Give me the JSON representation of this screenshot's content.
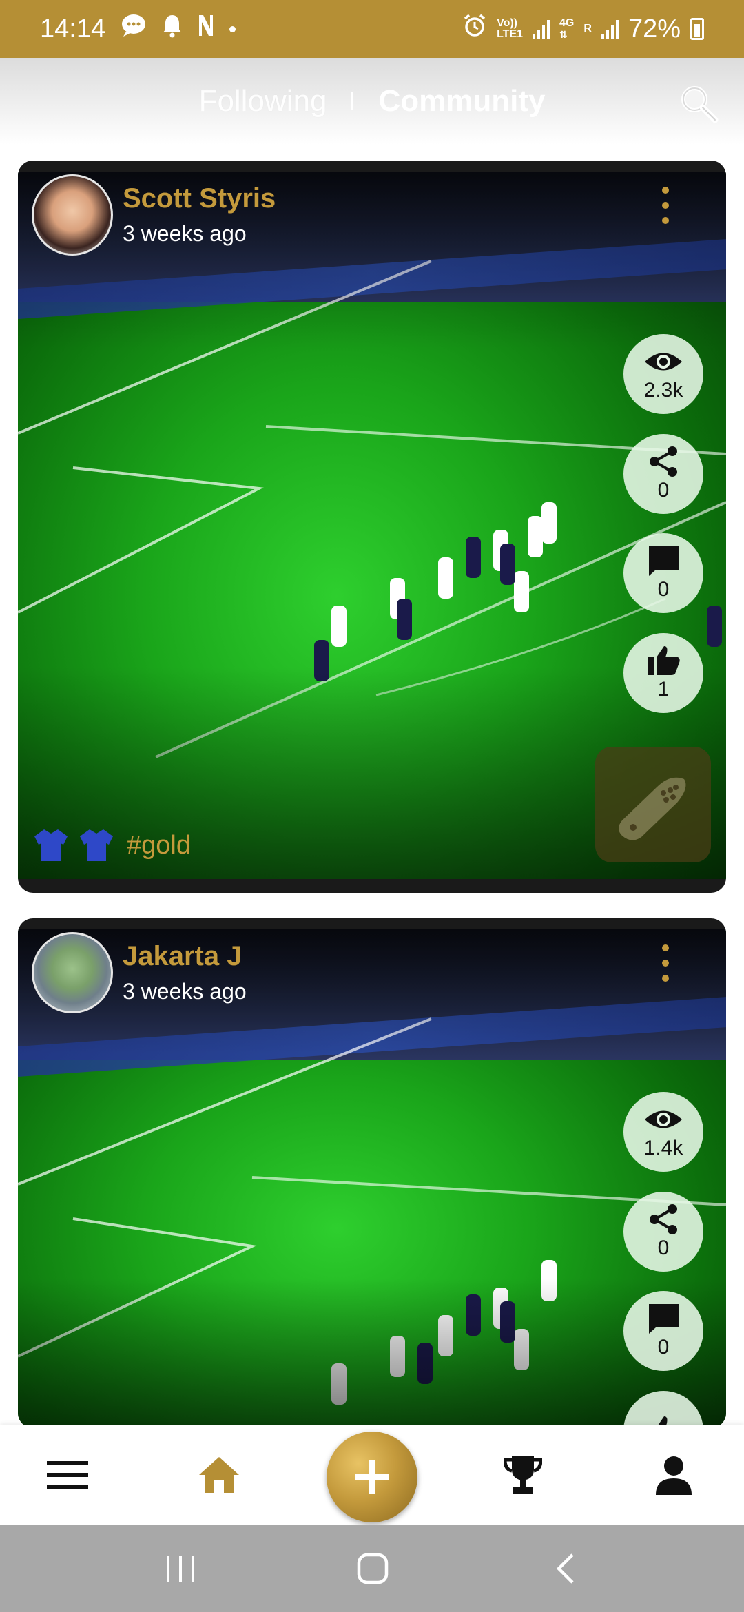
{
  "status_bar": {
    "time": "14:14",
    "notification_icons": [
      "chat-bubble-icon",
      "bell-icon",
      "n-icon",
      "dot-icon"
    ],
    "network_label_top": "Vo))",
    "network_label_bottom": "LTE1",
    "network_type": "4G",
    "roaming_label": "R",
    "battery": "72%"
  },
  "header": {
    "tab_following": "Following",
    "tab_community": "Community",
    "active_tab": "Community",
    "search_icon": "search-icon"
  },
  "posts": [
    {
      "author": "Scott Styris",
      "time": "3 weeks ago",
      "views": "2.3k",
      "shares": "0",
      "comments": "0",
      "likes": "1",
      "hashtag": "#gold",
      "jersey_count": 2
    },
    {
      "author": "Jakarta J",
      "time": "3 weeks ago",
      "views": "1.4k",
      "shares": "0",
      "comments": "0"
    }
  ],
  "bottom_nav": {
    "items": [
      "menu-icon",
      "home-icon",
      "add-icon",
      "trophy-icon",
      "profile-icon"
    ]
  },
  "colors": {
    "accent": "#b58f35",
    "gold_text": "#c49a3c",
    "system_nav": "#a8a8a8"
  }
}
